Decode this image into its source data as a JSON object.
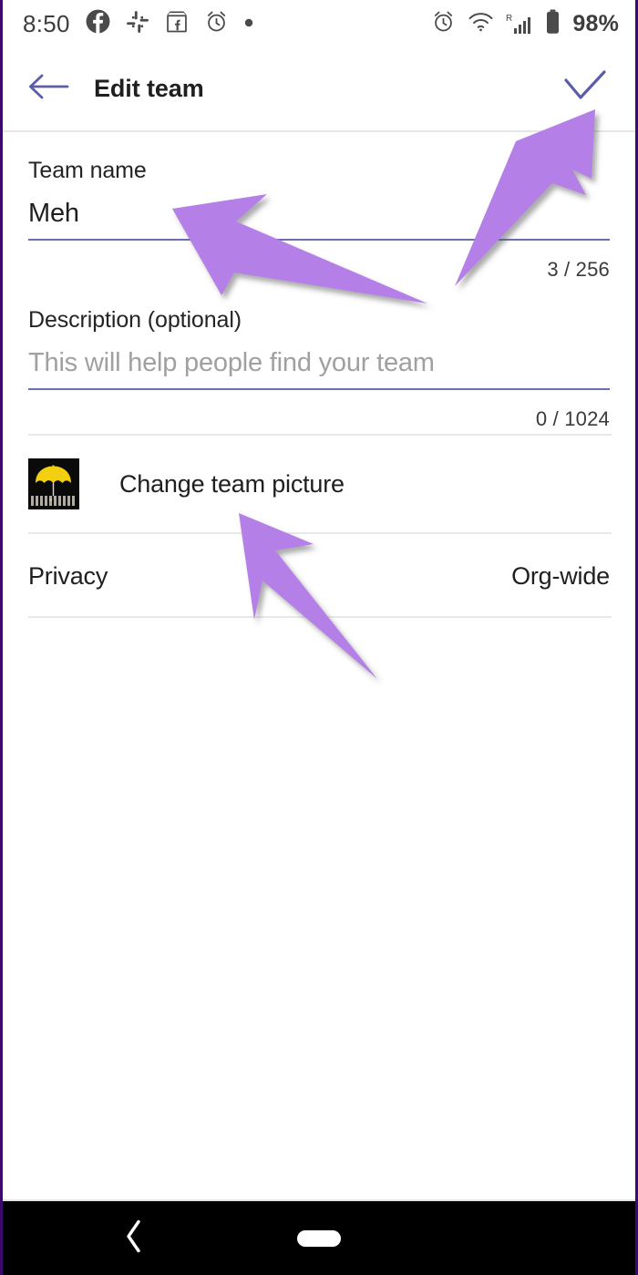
{
  "status_bar": {
    "time": "8:50",
    "battery_percent": "98%",
    "left_icons": [
      "facebook-icon",
      "slack-icon",
      "facebook-marketplace-icon",
      "alarm-clock-icon",
      "dot-icon"
    ],
    "right_icons": [
      "alarm-clock-icon",
      "wifi-icon",
      "roaming-signal-icon",
      "battery-icon"
    ],
    "roaming_label": "R"
  },
  "app_bar": {
    "back_icon": "arrow-left-icon",
    "title": "Edit team",
    "confirm_icon": "check-icon",
    "accent_color": "#5b5ea6"
  },
  "form": {
    "team_name": {
      "label": "Team name",
      "value": "Meh",
      "placeholder": "Team name",
      "counter": "3 / 256"
    },
    "description": {
      "label": "Description (optional)",
      "value": "",
      "placeholder": "This will help people find your team",
      "counter": "0 / 1024"
    }
  },
  "picture_row": {
    "label": "Change team picture",
    "avatar_icon": "umbrella-avatar"
  },
  "privacy_row": {
    "label": "Privacy",
    "value": "Org-wide"
  },
  "nav_bar": {
    "back_icon": "chevron-left-icon",
    "home_icon": "home-pill-icon"
  },
  "annotations": {
    "arrow_color": "#b57fe8",
    "arrows": [
      {
        "name": "arrow-to-team-name",
        "points_to": "Meh"
      },
      {
        "name": "arrow-to-confirm-check",
        "points_to": "check-icon"
      },
      {
        "name": "arrow-to-change-picture",
        "points_to": "Change team picture"
      }
    ]
  }
}
